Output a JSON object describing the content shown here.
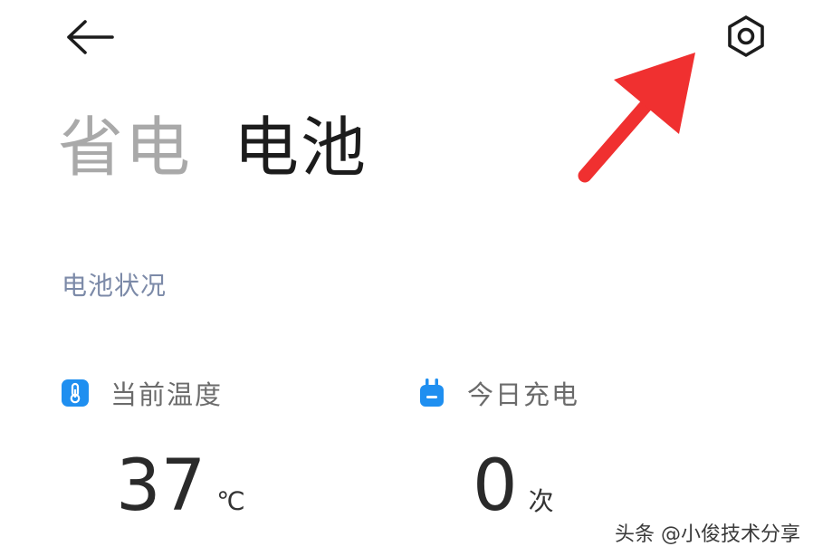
{
  "header": {
    "back_icon": "arrow-left-icon",
    "settings_icon": "hexagon-gear-icon"
  },
  "tabs": [
    {
      "label": "省电",
      "active": false
    },
    {
      "label": "电池",
      "active": true
    }
  ],
  "battery_status": {
    "section_title": "电池状况",
    "temperature": {
      "icon": "thermometer-icon",
      "label": "当前温度",
      "value": "37",
      "unit": "℃"
    },
    "charge_today": {
      "icon": "plug-icon",
      "label": "今日充电",
      "value": "0",
      "unit": "次"
    }
  },
  "annotation": {
    "arrow_color": "#f03030"
  },
  "watermark": "头条 @小俊技术分享",
  "colors": {
    "accent_blue": "#1f8ff0",
    "section_title": "#7c8aa8",
    "inactive_tab": "#a9a9a9",
    "active_tab": "#1c1c1c"
  }
}
